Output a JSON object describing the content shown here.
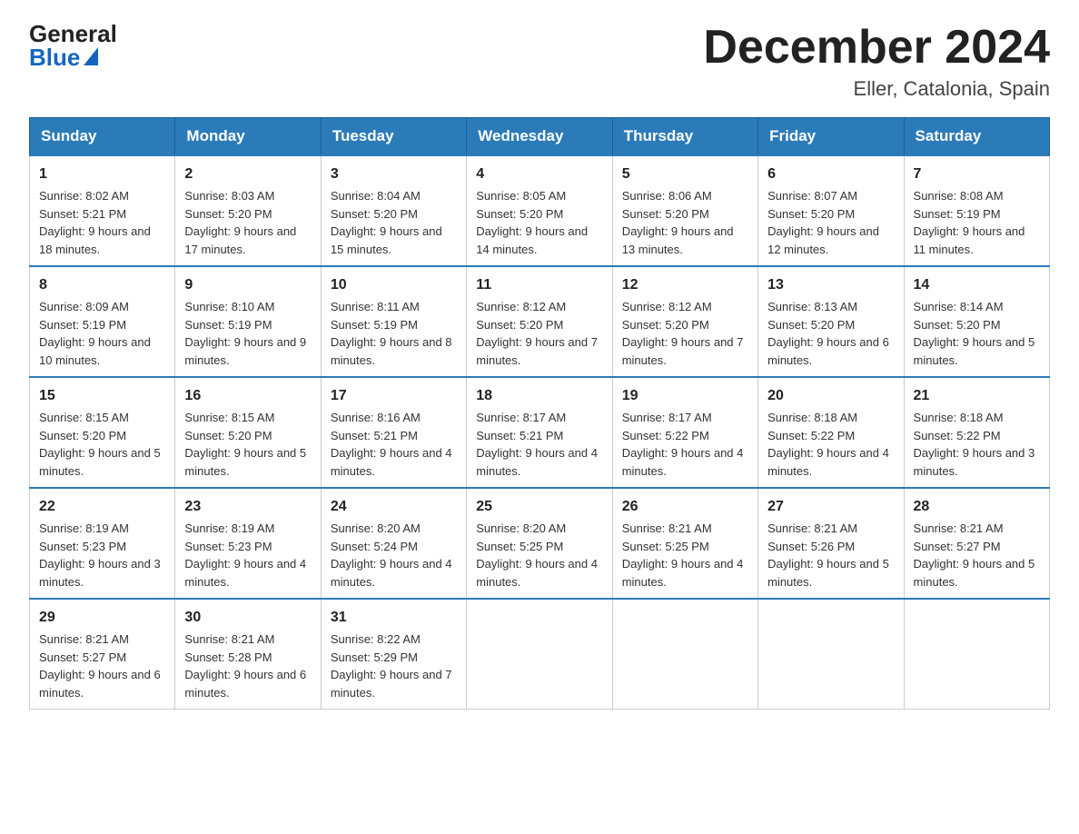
{
  "header": {
    "logo_general": "General",
    "logo_blue": "Blue",
    "title": "December 2024",
    "subtitle": "Eller, Catalonia, Spain"
  },
  "columns": [
    "Sunday",
    "Monday",
    "Tuesday",
    "Wednesday",
    "Thursday",
    "Friday",
    "Saturday"
  ],
  "weeks": [
    [
      {
        "num": "1",
        "sunrise": "8:02 AM",
        "sunset": "5:21 PM",
        "daylight": "9 hours and 18 minutes."
      },
      {
        "num": "2",
        "sunrise": "8:03 AM",
        "sunset": "5:20 PM",
        "daylight": "9 hours and 17 minutes."
      },
      {
        "num": "3",
        "sunrise": "8:04 AM",
        "sunset": "5:20 PM",
        "daylight": "9 hours and 15 minutes."
      },
      {
        "num": "4",
        "sunrise": "8:05 AM",
        "sunset": "5:20 PM",
        "daylight": "9 hours and 14 minutes."
      },
      {
        "num": "5",
        "sunrise": "8:06 AM",
        "sunset": "5:20 PM",
        "daylight": "9 hours and 13 minutes."
      },
      {
        "num": "6",
        "sunrise": "8:07 AM",
        "sunset": "5:20 PM",
        "daylight": "9 hours and 12 minutes."
      },
      {
        "num": "7",
        "sunrise": "8:08 AM",
        "sunset": "5:19 PM",
        "daylight": "9 hours and 11 minutes."
      }
    ],
    [
      {
        "num": "8",
        "sunrise": "8:09 AM",
        "sunset": "5:19 PM",
        "daylight": "9 hours and 10 minutes."
      },
      {
        "num": "9",
        "sunrise": "8:10 AM",
        "sunset": "5:19 PM",
        "daylight": "9 hours and 9 minutes."
      },
      {
        "num": "10",
        "sunrise": "8:11 AM",
        "sunset": "5:19 PM",
        "daylight": "9 hours and 8 minutes."
      },
      {
        "num": "11",
        "sunrise": "8:12 AM",
        "sunset": "5:20 PM",
        "daylight": "9 hours and 7 minutes."
      },
      {
        "num": "12",
        "sunrise": "8:12 AM",
        "sunset": "5:20 PM",
        "daylight": "9 hours and 7 minutes."
      },
      {
        "num": "13",
        "sunrise": "8:13 AM",
        "sunset": "5:20 PM",
        "daylight": "9 hours and 6 minutes."
      },
      {
        "num": "14",
        "sunrise": "8:14 AM",
        "sunset": "5:20 PM",
        "daylight": "9 hours and 5 minutes."
      }
    ],
    [
      {
        "num": "15",
        "sunrise": "8:15 AM",
        "sunset": "5:20 PM",
        "daylight": "9 hours and 5 minutes."
      },
      {
        "num": "16",
        "sunrise": "8:15 AM",
        "sunset": "5:20 PM",
        "daylight": "9 hours and 5 minutes."
      },
      {
        "num": "17",
        "sunrise": "8:16 AM",
        "sunset": "5:21 PM",
        "daylight": "9 hours and 4 minutes."
      },
      {
        "num": "18",
        "sunrise": "8:17 AM",
        "sunset": "5:21 PM",
        "daylight": "9 hours and 4 minutes."
      },
      {
        "num": "19",
        "sunrise": "8:17 AM",
        "sunset": "5:22 PM",
        "daylight": "9 hours and 4 minutes."
      },
      {
        "num": "20",
        "sunrise": "8:18 AM",
        "sunset": "5:22 PM",
        "daylight": "9 hours and 4 minutes."
      },
      {
        "num": "21",
        "sunrise": "8:18 AM",
        "sunset": "5:22 PM",
        "daylight": "9 hours and 3 minutes."
      }
    ],
    [
      {
        "num": "22",
        "sunrise": "8:19 AM",
        "sunset": "5:23 PM",
        "daylight": "9 hours and 3 minutes."
      },
      {
        "num": "23",
        "sunrise": "8:19 AM",
        "sunset": "5:23 PM",
        "daylight": "9 hours and 4 minutes."
      },
      {
        "num": "24",
        "sunrise": "8:20 AM",
        "sunset": "5:24 PM",
        "daylight": "9 hours and 4 minutes."
      },
      {
        "num": "25",
        "sunrise": "8:20 AM",
        "sunset": "5:25 PM",
        "daylight": "9 hours and 4 minutes."
      },
      {
        "num": "26",
        "sunrise": "8:21 AM",
        "sunset": "5:25 PM",
        "daylight": "9 hours and 4 minutes."
      },
      {
        "num": "27",
        "sunrise": "8:21 AM",
        "sunset": "5:26 PM",
        "daylight": "9 hours and 5 minutes."
      },
      {
        "num": "28",
        "sunrise": "8:21 AM",
        "sunset": "5:27 PM",
        "daylight": "9 hours and 5 minutes."
      }
    ],
    [
      {
        "num": "29",
        "sunrise": "8:21 AM",
        "sunset": "5:27 PM",
        "daylight": "9 hours and 6 minutes."
      },
      {
        "num": "30",
        "sunrise": "8:21 AM",
        "sunset": "5:28 PM",
        "daylight": "9 hours and 6 minutes."
      },
      {
        "num": "31",
        "sunrise": "8:22 AM",
        "sunset": "5:29 PM",
        "daylight": "9 hours and 7 minutes."
      },
      null,
      null,
      null,
      null
    ]
  ],
  "labels": {
    "sunrise": "Sunrise:",
    "sunset": "Sunset:",
    "daylight": "Daylight:"
  }
}
